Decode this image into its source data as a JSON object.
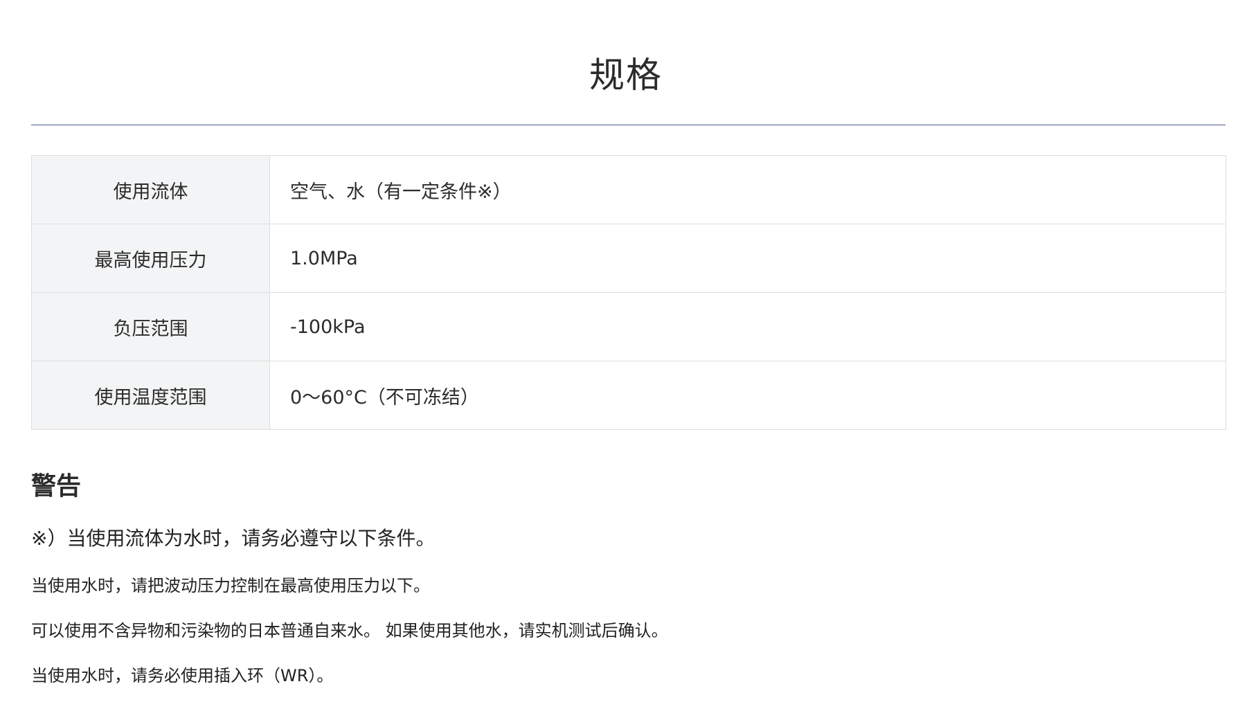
{
  "page_title": "规格",
  "specs": [
    {
      "label": "使用流体",
      "value": "空气、水（有一定条件※）"
    },
    {
      "label": "最高使用压力",
      "value": "1.0MPa"
    },
    {
      "label": "负压范围",
      "value": "-100kPa"
    },
    {
      "label": "使用温度范围",
      "value": "0～60°C（不可冻结）"
    }
  ],
  "warning": {
    "heading": "警告",
    "intro": "※）当使用流体为水时，请务必遵守以下条件。",
    "items": [
      "当使用水时，请把波动压力控制在最高使用压力以下。",
      "可以使用不含异物和污染物的日本普通自来水。 如果使用其他水，请实机测试后确认。",
      "当使用水时，请务必使用插入环（WR）。"
    ]
  },
  "colors": {
    "rule": "#4a5a8a",
    "label_bg": "#f3f4f5",
    "border": "#dedede",
    "text": "#222222"
  }
}
